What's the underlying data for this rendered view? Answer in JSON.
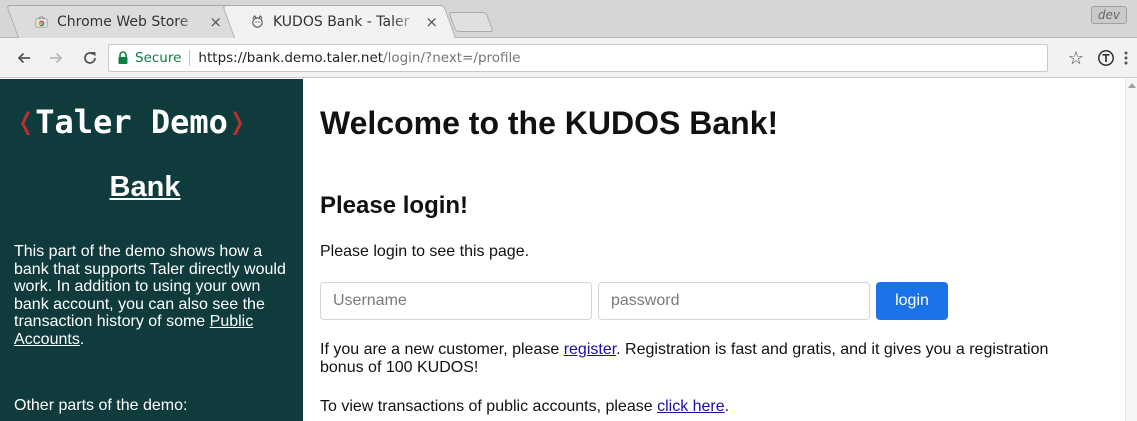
{
  "tabs": [
    {
      "title": "Chrome Web Store",
      "icon": "chrome-web-store-icon",
      "close": "×",
      "active": false
    },
    {
      "title": "KUDOS Bank - Taler",
      "icon": "taler-favicon-icon",
      "close": "×",
      "active": true
    }
  ],
  "profile_badge": "dev",
  "toolbar": {
    "secure_label": "Secure",
    "url_host": "https://bank.demo.taler.net",
    "url_path": "/login/?next=/profile",
    "star": "☆"
  },
  "sidebar": {
    "brand_open": "❬",
    "brand_name": "Taler Demo",
    "brand_close": "❭",
    "bank_label": "Bank",
    "desc_text": "This part of the demo shows how a bank that supports Taler directly would work. In addition to using your own bank account, you can also see the transaction history of some ",
    "public_accounts_link": "Public Accounts",
    "desc_end": ".",
    "other_parts": "Other parts of the demo:"
  },
  "main": {
    "title": "Welcome to the KUDOS Bank!",
    "login_heading": "Please login!",
    "login_intro": "Please login to see this page.",
    "username_placeholder": "Username",
    "password_placeholder": "password",
    "login_button": "login",
    "register_before": "If you are a new customer, please ",
    "register_link": "register",
    "register_after": ". Registration is fast and gratis, and it gives you a registration bonus of 100 KUDOS!",
    "public_before": "To view transactions of public accounts, please ",
    "public_link": "click here",
    "public_after": "."
  },
  "colors": {
    "sidebar_bg": "#0f3b3d",
    "bracket": "#b7332d",
    "login_button": "#1a73e8",
    "secure_green": "#0b8043",
    "link": "#1a0dab"
  }
}
